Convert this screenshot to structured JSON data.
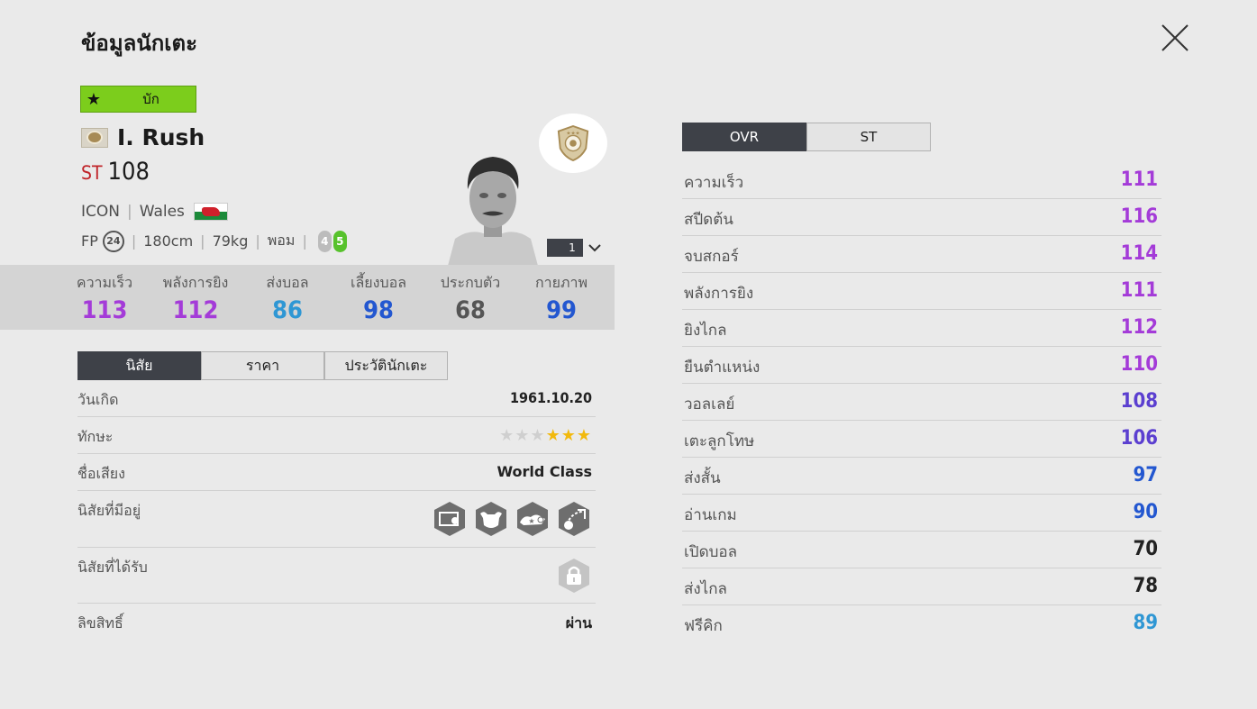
{
  "header": {
    "title": "ข้อมูลนักเตะ"
  },
  "season": {
    "label": "บัก"
  },
  "player": {
    "name": "I. Rush",
    "position": "ST",
    "ovr": "108",
    "category": "ICON",
    "nation": "Wales",
    "fp_label": "FP",
    "fp": "24",
    "height": "180cm",
    "weight": "79kg",
    "foot": "พอม",
    "weak_foot_left": "4",
    "weak_foot_right": "5",
    "level": "1"
  },
  "summary_stats": [
    {
      "label": "ความเร็ว",
      "value": "113",
      "color": "#a43bd8"
    },
    {
      "label": "พลังการยิง",
      "value": "112",
      "color": "#a43bd8"
    },
    {
      "label": "ส่งบอล",
      "value": "86",
      "color": "#2f97d4"
    },
    {
      "label": "เลี้ยงบอล",
      "value": "98",
      "color": "#2357d0"
    },
    {
      "label": "ประกบตัว",
      "value": "68",
      "color": "#555555"
    },
    {
      "label": "กายภาพ",
      "value": "99",
      "color": "#2357d0"
    }
  ],
  "tabs": [
    "นิสัย",
    "ราคา",
    "ประวัตินักเตะ"
  ],
  "details": {
    "birth": {
      "label": "วันเกิด",
      "value": "1961.10.20"
    },
    "skill": {
      "label": "ทักษะ",
      "stars": 3,
      "max": 6
    },
    "reputation": {
      "label": "ชื่อเสียง",
      "value": "World Class"
    },
    "traits_owned": {
      "label": "นิสัยที่มีอยู่",
      "icons": [
        "goalkeeper-chip-trait-icon",
        "bull-power-trait-icon",
        "speed-dribbler-trait-icon",
        "long-shot-trait-icon"
      ]
    },
    "traits_acquired": {
      "label": "นิสัยที่ได้รับ",
      "icon": "lock-icon"
    },
    "license": {
      "label": "ลิขสิทธิ์",
      "value": "ผ่าน"
    }
  },
  "ovr_tabs": [
    "OVR",
    "ST"
  ],
  "attributes": [
    {
      "name": "ความเร็ว",
      "value": "111",
      "color": "#a43bd8"
    },
    {
      "name": "สปีดต้น",
      "value": "116",
      "color": "#a43bd8"
    },
    {
      "name": "จบสกอร์",
      "value": "114",
      "color": "#a43bd8"
    },
    {
      "name": "พลังการยิง",
      "value": "111",
      "color": "#a43bd8"
    },
    {
      "name": "ยิงไกล",
      "value": "112",
      "color": "#a43bd8"
    },
    {
      "name": "ยืนตำแหน่ง",
      "value": "110",
      "color": "#a43bd8"
    },
    {
      "name": "วอลเลย์",
      "value": "108",
      "color": "#5b3fd0"
    },
    {
      "name": "เตะลูกโทษ",
      "value": "106",
      "color": "#5b3fd0"
    },
    {
      "name": "ส่งสั้น",
      "value": "97",
      "color": "#2357d0"
    },
    {
      "name": "อ่านเกม",
      "value": "90",
      "color": "#2357d0"
    },
    {
      "name": "เปิดบอล",
      "value": "70",
      "color": "#222222"
    },
    {
      "name": "ส่งไกล",
      "value": "78",
      "color": "#222222"
    },
    {
      "name": "ฟรีคิก",
      "value": "89",
      "color": "#2f97d4"
    }
  ]
}
